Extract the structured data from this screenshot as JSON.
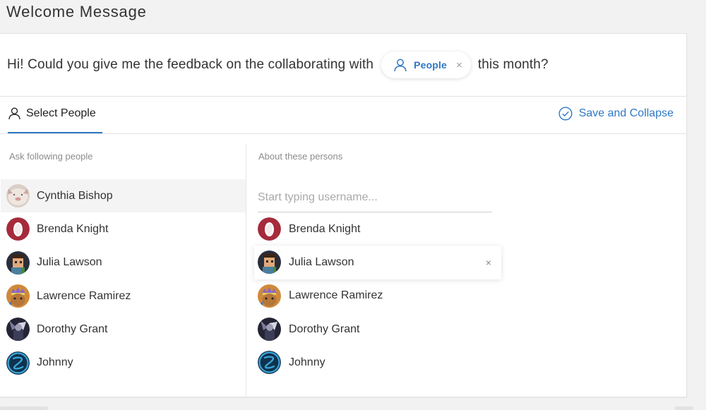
{
  "page": {
    "title": "Welcome Message"
  },
  "message": {
    "prefix": "Hi! Could you give me the feedback on the collaborating with",
    "chip_label": "People",
    "chip_remove": "×",
    "suffix": "this month?"
  },
  "tabs": {
    "select_people": "Select People",
    "save_collapse": "Save and Collapse"
  },
  "left_column": {
    "label": "Ask following people",
    "people": [
      {
        "name": "Cynthia Bishop",
        "avatar": "cat-avatar",
        "highlighted": true
      },
      {
        "name": "Brenda Knight",
        "avatar": "egg-avatar"
      },
      {
        "name": "Julia Lawson",
        "avatar": "pixel-avatar"
      },
      {
        "name": "Lawrence Ramirez",
        "avatar": "king-avatar"
      },
      {
        "name": "Dorothy Grant",
        "avatar": "dark-avatar"
      },
      {
        "name": "Johnny",
        "avatar": "z-logo-avatar"
      }
    ]
  },
  "right_column": {
    "label": "About these persons",
    "search_placeholder": "Start typing username...",
    "remove_glyph": "×",
    "people": [
      {
        "name": "Brenda Knight",
        "avatar": "egg-avatar"
      },
      {
        "name": "Julia Lawson",
        "avatar": "pixel-avatar",
        "hovered": true
      },
      {
        "name": "Lawrence Ramirez",
        "avatar": "king-avatar"
      },
      {
        "name": "Dorothy Grant",
        "avatar": "dark-avatar"
      },
      {
        "name": "Johnny",
        "avatar": "z-logo-avatar"
      }
    ]
  },
  "colors": {
    "accent": "#2f78c4",
    "text": "#333333",
    "muted": "#8c8c8c",
    "page_bg": "#f2f2f2",
    "card_bg": "#ffffff"
  }
}
